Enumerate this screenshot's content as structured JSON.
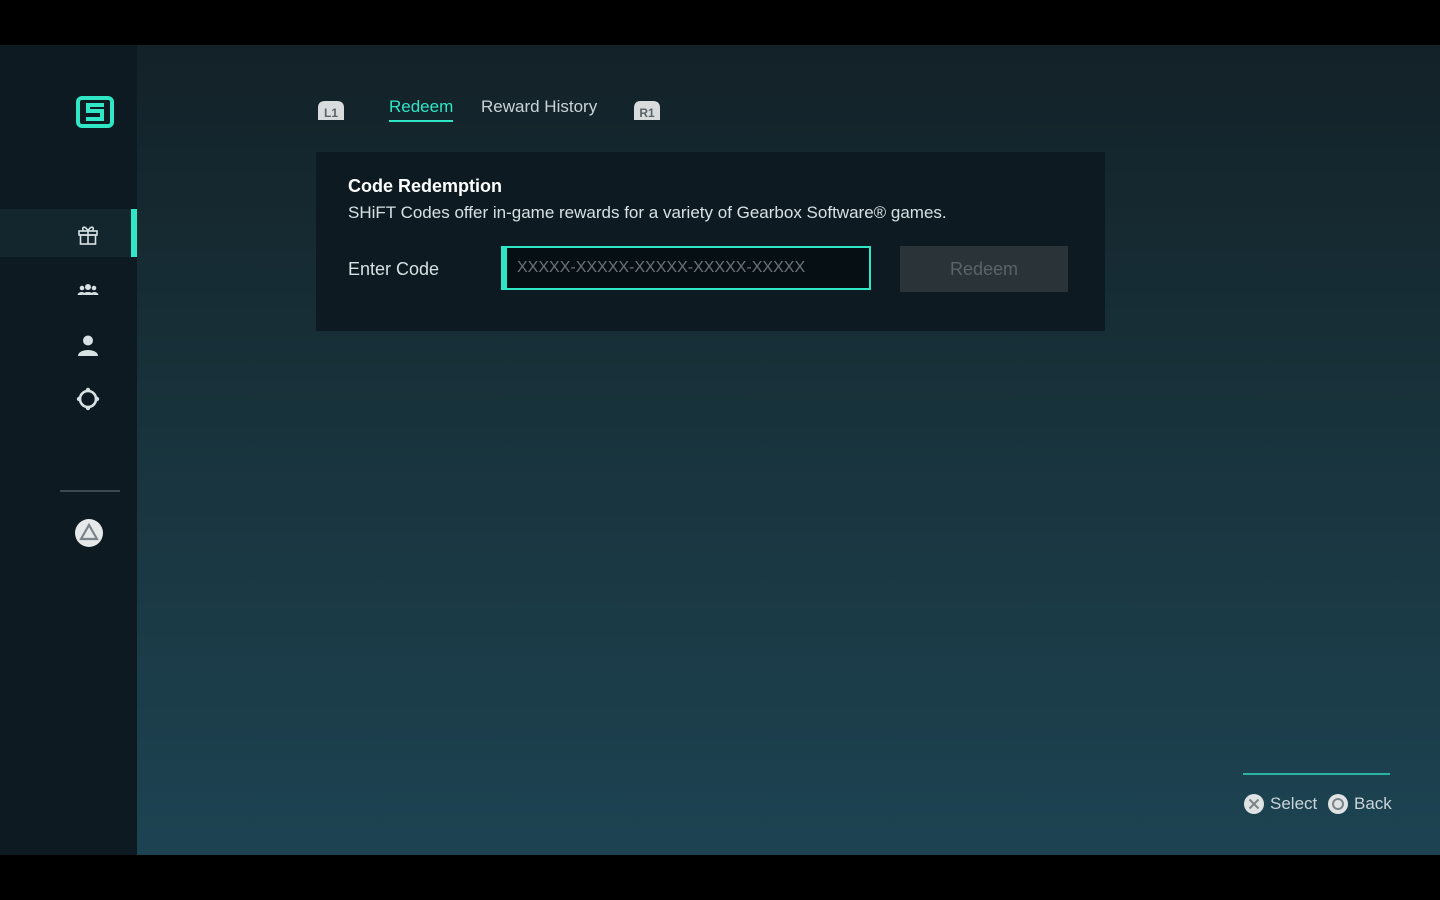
{
  "colors": {
    "accent": "#2fe6c6",
    "panel": "#0d1a21",
    "sidebar": "#0d1a21"
  },
  "sidebar": {
    "logo_icon": "shift-logo-icon",
    "items": [
      {
        "icon": "gift-icon",
        "active": true
      },
      {
        "icon": "friends-icon",
        "active": false
      },
      {
        "icon": "profile-icon",
        "active": false
      },
      {
        "icon": "settings-icon",
        "active": false
      }
    ],
    "footer_icon": "playstation-triangle-icon"
  },
  "tabs": {
    "left_bumper": "L1",
    "right_bumper": "R1",
    "items": [
      {
        "label": "Redeem",
        "active": true
      },
      {
        "label": "Reward History",
        "active": false
      }
    ]
  },
  "redemption": {
    "title": "Code Redemption",
    "description": "SHiFT Codes offer in-game rewards for a variety of Gearbox Software® games.",
    "field_label": "Enter Code",
    "placeholder": "XXXXX-XXXXX-XXXXX-XXXXX-XXXXX",
    "value": "",
    "button_label": "Redeem"
  },
  "hints": [
    {
      "icon": "cross-button-icon",
      "label": "Select"
    },
    {
      "icon": "circle-button-icon",
      "label": "Back"
    }
  ]
}
